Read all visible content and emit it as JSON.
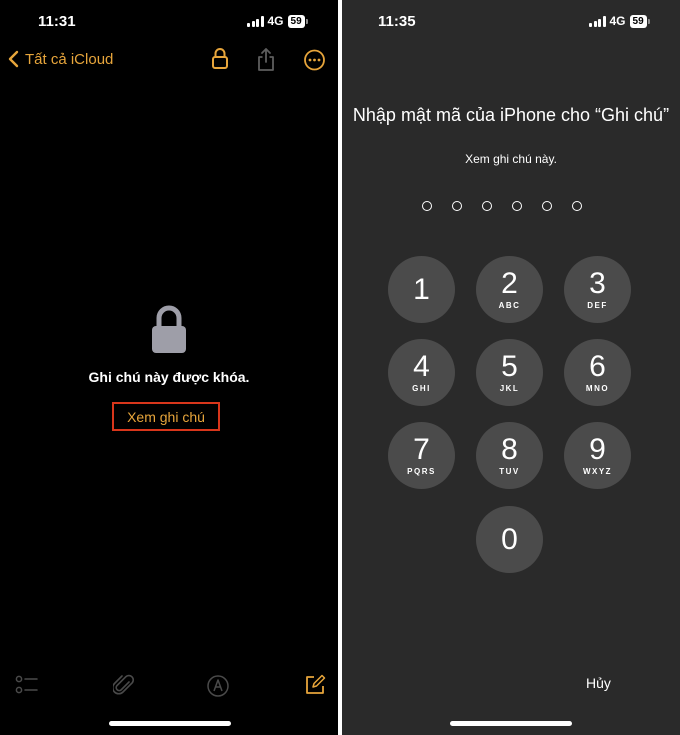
{
  "left_screen": {
    "status_bar": {
      "time": "11:31",
      "network": "4G",
      "battery": "59"
    },
    "nav": {
      "back_label": "Tất cả iCloud"
    },
    "locked_message": "Ghi chú này được khóa.",
    "view_button_label": "Xem ghi chú",
    "colors": {
      "accent": "#e7a53b",
      "highlight_box": "#d9361b"
    },
    "icons": [
      "lock-icon",
      "share-icon",
      "more-icon",
      "checklist-icon",
      "attachment-icon",
      "markup-icon",
      "compose-icon"
    ]
  },
  "right_screen": {
    "status_bar": {
      "time": "11:35",
      "network": "4G",
      "battery": "59"
    },
    "prompt_title": "Nhập mật mã của iPhone cho “Ghi chú”",
    "prompt_subtitle": "Xem ghi chú này.",
    "passcode_length": 6,
    "keys": [
      {
        "digit": "1",
        "letters": ""
      },
      {
        "digit": "2",
        "letters": "ABC"
      },
      {
        "digit": "3",
        "letters": "DEF"
      },
      {
        "digit": "4",
        "letters": "GHI"
      },
      {
        "digit": "5",
        "letters": "JKL"
      },
      {
        "digit": "6",
        "letters": "MNO"
      },
      {
        "digit": "7",
        "letters": "PQRS"
      },
      {
        "digit": "8",
        "letters": "TUV"
      },
      {
        "digit": "9",
        "letters": "WXYZ"
      },
      {
        "digit": "0",
        "letters": ""
      }
    ],
    "cancel_label": "Hủy"
  }
}
